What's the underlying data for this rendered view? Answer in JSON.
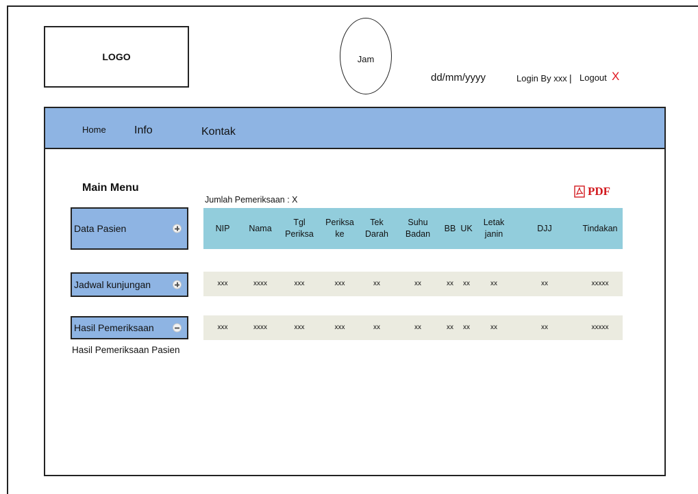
{
  "header": {
    "logo": "LOGO",
    "clock": "Jam",
    "date": "dd/mm/yyyy",
    "login": "Login By xxx",
    "separator": "|",
    "logout": "Logout",
    "logout_mark": "X"
  },
  "nav": {
    "items": [
      {
        "label": "Home"
      },
      {
        "label": "Info"
      },
      {
        "label": "Kontak"
      }
    ]
  },
  "sidebar": {
    "title": "Main Menu",
    "items": [
      {
        "label": "Data Pasien",
        "icon": "plus-icon"
      },
      {
        "label": "Jadwal kunjungan",
        "icon": "plus-icon"
      },
      {
        "label": "Hasil Pemeriksaan",
        "icon": "minus-icon"
      }
    ],
    "submenu": "Hasil Pemeriksaan Pasien"
  },
  "content": {
    "count_label": "Jumlah  Pemeriksaan : X",
    "pdf_label": "PDF",
    "pdf_icon": "pdf-icon",
    "table": {
      "headers": [
        [
          "NIP"
        ],
        [
          "Nama"
        ],
        [
          "Tgl",
          "Periksa"
        ],
        [
          "Periksa",
          "ke"
        ],
        [
          "Tek",
          "Darah"
        ],
        [
          "Suhu",
          "Badan"
        ],
        [
          "BB"
        ],
        [
          "UK"
        ],
        [
          "Letak",
          "janin"
        ],
        [
          "DJJ"
        ],
        [
          "Tindakan"
        ]
      ],
      "rows": [
        [
          "xxx",
          "xxxx",
          "xxx",
          "xxx",
          "xx",
          "xx",
          "xx",
          "xx",
          "xx",
          "xx",
          "xxxxx"
        ],
        [
          "xxx",
          "xxxx",
          "xxx",
          "xxx",
          "xx",
          "xx",
          "xx",
          "xx",
          "xx",
          "xx",
          "xxxxx"
        ]
      ]
    }
  },
  "colors": {
    "nav_bg": "#8eb4e3",
    "table_header_bg": "#92cddc",
    "row_bg": "#ebebe0",
    "accent_red": "#d2191e"
  }
}
